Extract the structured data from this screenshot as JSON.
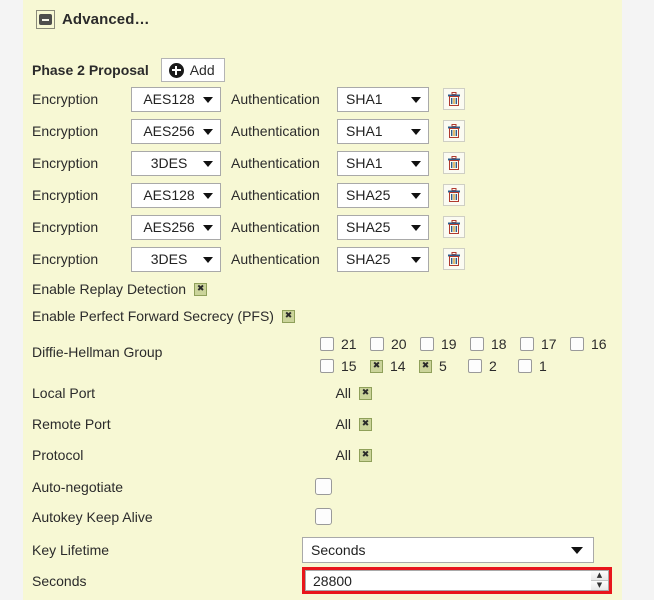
{
  "section": {
    "title": "Advanced…",
    "collapse_icon": "minus-box-icon"
  },
  "proposal": {
    "label": "Phase 2 Proposal",
    "add_label": "Add",
    "add_icon": "plus-circle-icon",
    "delete_icon": "trash-icon",
    "encryption_label": "Encryption",
    "authentication_label": "Authentication",
    "rows": [
      {
        "encryption": "AES128",
        "authentication": "SHA1"
      },
      {
        "encryption": "AES256",
        "authentication": "SHA1"
      },
      {
        "encryption": "3DES",
        "authentication": "SHA1"
      },
      {
        "encryption": "AES128",
        "authentication": "SHA25"
      },
      {
        "encryption": "AES256",
        "authentication": "SHA25"
      },
      {
        "encryption": "3DES",
        "authentication": "SHA25"
      }
    ]
  },
  "toggles": [
    {
      "label": "Enable Replay Detection",
      "checked": true
    },
    {
      "label": "Enable Perfect Forward Secrecy (PFS)",
      "checked": true
    }
  ],
  "diffie_hellman": {
    "label": "Diffie-Hellman Group",
    "rows": [
      [
        {
          "value": "21",
          "checked": false
        },
        {
          "value": "20",
          "checked": false
        },
        {
          "value": "19",
          "checked": false
        },
        {
          "value": "18",
          "checked": false
        },
        {
          "value": "17",
          "checked": false
        },
        {
          "value": "16",
          "checked": false
        }
      ],
      [
        {
          "value": "15",
          "checked": false
        },
        {
          "value": "14",
          "checked": true
        },
        {
          "value": "5",
          "checked": true
        },
        {
          "value": "2",
          "checked": false
        },
        {
          "value": "1",
          "checked": false
        }
      ]
    ]
  },
  "all_rows": [
    {
      "label": "Local Port",
      "value": "All",
      "checked": true
    },
    {
      "label": "Remote Port",
      "value": "All",
      "checked": true
    },
    {
      "label": "Protocol",
      "value": "All",
      "checked": true
    }
  ],
  "simple_rows": [
    {
      "label": "Auto-negotiate",
      "checked": false
    },
    {
      "label": "Autokey Keep Alive",
      "checked": false
    }
  ],
  "key_lifetime": {
    "label": "Key Lifetime",
    "value": "Seconds"
  },
  "seconds": {
    "label": "Seconds",
    "value": "28800",
    "spinner_up": "▲",
    "spinner_down": "▼",
    "highlight_color": "#e8161b"
  },
  "colors": {
    "panel_bg": "#f7f8d4",
    "page_bg": "#f4f4f4",
    "checked_box": "#cbd49a",
    "highlight": "#e8161b"
  }
}
